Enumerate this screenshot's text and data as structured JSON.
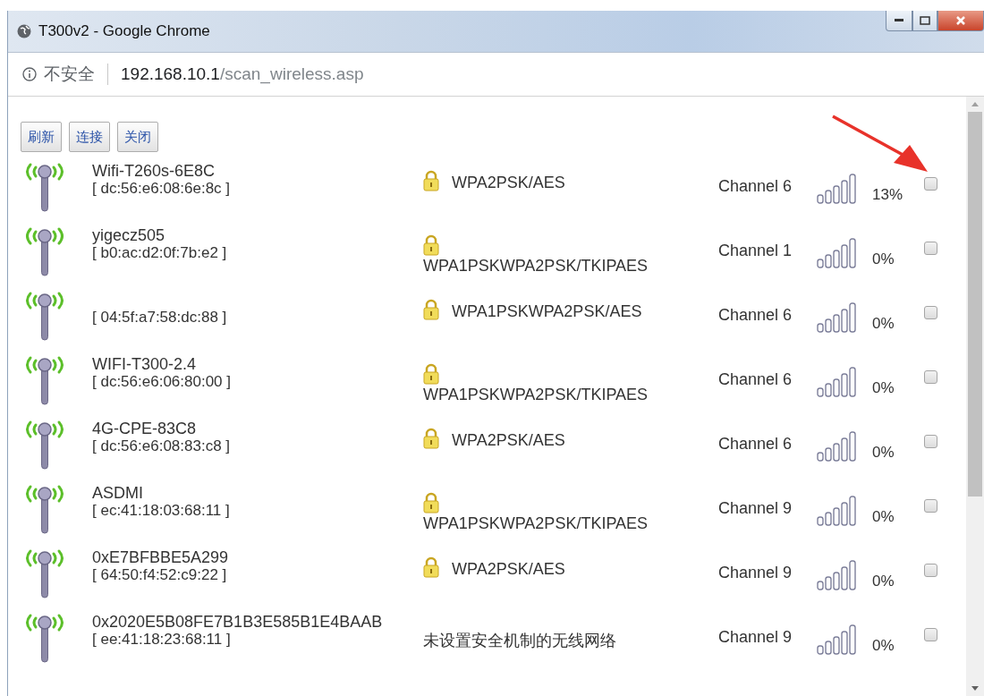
{
  "window": {
    "title": "T300v2 - Google Chrome"
  },
  "address_bar": {
    "security_label": "不安全",
    "host": "192.168.10.1",
    "path": "/scan_wireless.asp"
  },
  "buttons": [
    "刷新",
    "连接",
    "关闭"
  ],
  "networks": [
    {
      "ssid": "Wifi-T260s-6E8C",
      "mac": "[ dc:56:e6:08:6e:8c ]",
      "locked": true,
      "security": "WPA2PSK/AES",
      "channel": "Channel 6",
      "signal": "13%",
      "checked": false
    },
    {
      "ssid": "yigecz505",
      "mac": "[ b0:ac:d2:0f:7b:e2 ]",
      "locked": true,
      "security": "WPA1PSKWPA2PSK/TKIPAES",
      "channel": "Channel 1",
      "signal": "0%",
      "checked": false
    },
    {
      "mac": "[ 04:5f:a7:58:dc:88 ]",
      "locked": true,
      "security": "WPA1PSKWPA2PSK/AES",
      "channel": "Channel 6",
      "signal": "0%",
      "checked": false
    },
    {
      "ssid": "WIFI-T300-2.4",
      "mac": "[ dc:56:e6:06:80:00 ]",
      "locked": true,
      "security": "WPA1PSKWPA2PSK/TKIPAES",
      "channel": "Channel 6",
      "signal": "0%",
      "checked": false
    },
    {
      "ssid": "4G-CPE-83C8",
      "mac": "[ dc:56:e6:08:83:c8 ]",
      "locked": true,
      "security": "WPA2PSK/AES",
      "channel": "Channel 6",
      "signal": "0%",
      "checked": false
    },
    {
      "ssid": "ASDMI",
      "mac": "[ ec:41:18:03:68:11 ]",
      "locked": true,
      "security": "WPA1PSKWPA2PSK/TKIPAES",
      "channel": "Channel 9",
      "signal": "0%",
      "checked": false
    },
    {
      "ssid": "0xE7BFBBE5A299",
      "mac": "[ 64:50:f4:52:c9:22 ]",
      "locked": true,
      "security": "WPA2PSK/AES",
      "channel": "Channel 9",
      "signal": "0%",
      "checked": false
    },
    {
      "ssid": "0x2020E5B08FE7B1B3E585B1E4BAAB",
      "mac": "[ ee:41:18:23:68:11 ]",
      "locked": false,
      "security": "未设置安全机制的无线网络",
      "channel": "Channel 9",
      "signal": "0%",
      "checked": false
    }
  ]
}
